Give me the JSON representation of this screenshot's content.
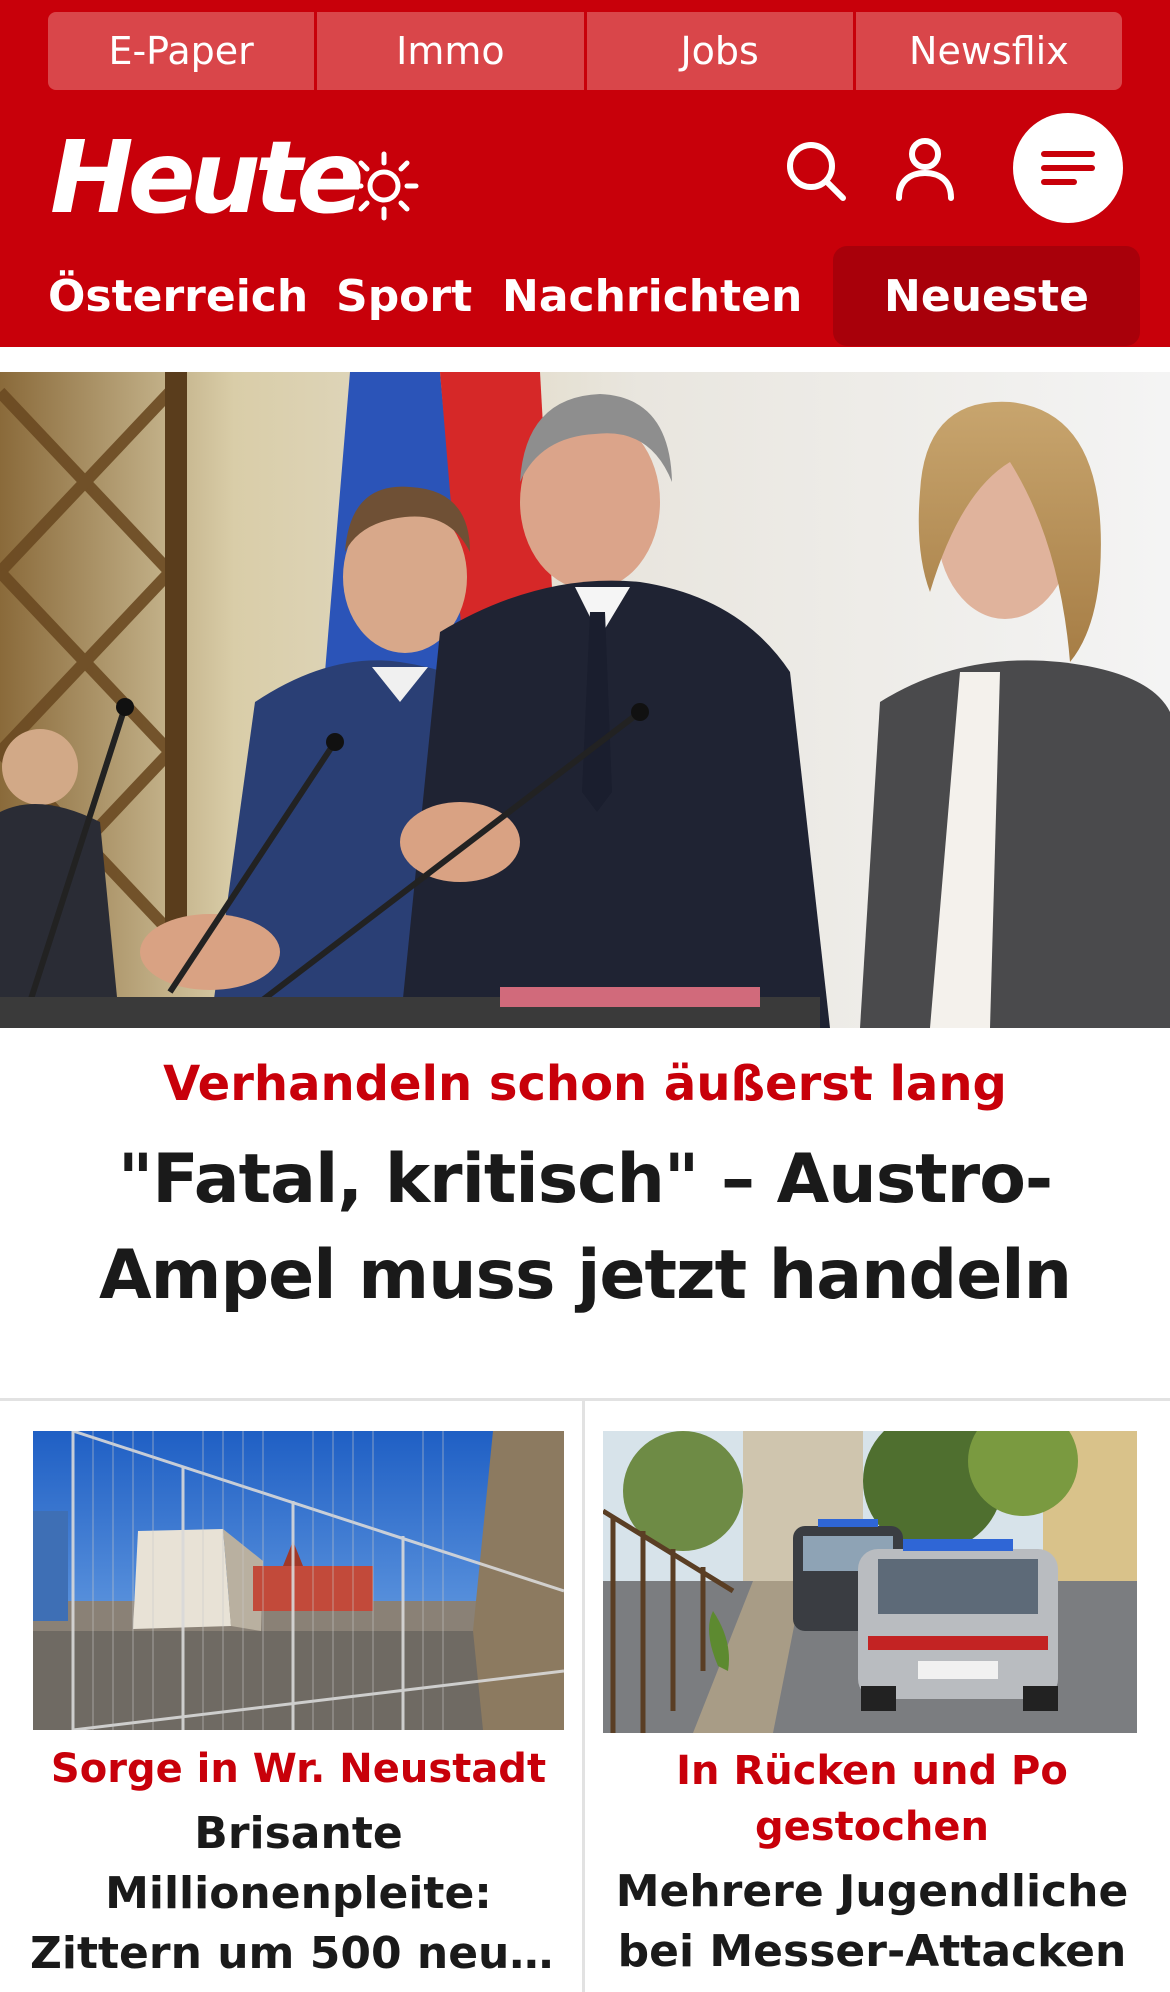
{
  "top_links": [
    "E-Paper",
    "Immo",
    "Jobs",
    "Newsflix"
  ],
  "brand": {
    "logo_text": "Heute",
    "accent_color": "#c8000a"
  },
  "header_icons": [
    "sun-icon",
    "search-icon",
    "user-icon",
    "menu-icon"
  ],
  "nav": {
    "items": [
      "Österreich",
      "Sport",
      "Nachrichten"
    ],
    "active": "Neueste"
  },
  "hero": {
    "image": "press-conference-photo",
    "kicker": "Verhandeln schon äußerst lang",
    "title": "\"Fatal, kritisch\" – Austro-Ampel muss jetzt handeln"
  },
  "cards": [
    {
      "image": "construction-site-fence-photo",
      "kicker": "Sorge in Wr. Neustadt",
      "title_lines": [
        "Brisante",
        "Millionenpleite:",
        "Zittern um 500 neue..."
      ]
    },
    {
      "image": "police-cars-street-photo",
      "kicker": "In Rücken und Po gestochen",
      "title": "Mehrere Jugendliche bei Messer-Attacken"
    }
  ]
}
